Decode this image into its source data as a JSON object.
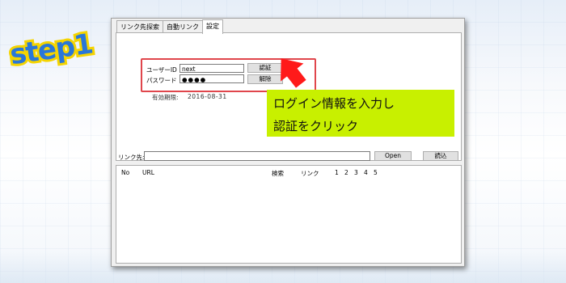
{
  "step_label": "step1",
  "tabs": [
    {
      "label": "リンク先探索"
    },
    {
      "label": "自動リンク"
    },
    {
      "label": "設定"
    }
  ],
  "settings": {
    "user_id_label": "ユーザーID",
    "user_id_value": "next",
    "password_label": "パスワード",
    "password_value": "●●●●",
    "auth_button": "認証",
    "cancel_button": "解除",
    "expiry_label": "有効期限:",
    "expiry_value": "2016-08-31"
  },
  "link_bar": {
    "label": "リンク先:",
    "value": "",
    "open_button": "Open",
    "load_button": "読込"
  },
  "table": {
    "columns": [
      "No",
      "URL",
      "検索",
      "リンク",
      "1",
      "2",
      "3",
      "4",
      "5"
    ],
    "rows": []
  },
  "callout": {
    "line1": "ログイン情報を入力し",
    "line2": "認証をクリック",
    "color": "#c8f000"
  },
  "colors": {
    "highlight_border": "#e0464c",
    "arrow": "#ff1a1a",
    "logo_fill": "#2a77d8",
    "logo_outline": "#f5d400"
  }
}
